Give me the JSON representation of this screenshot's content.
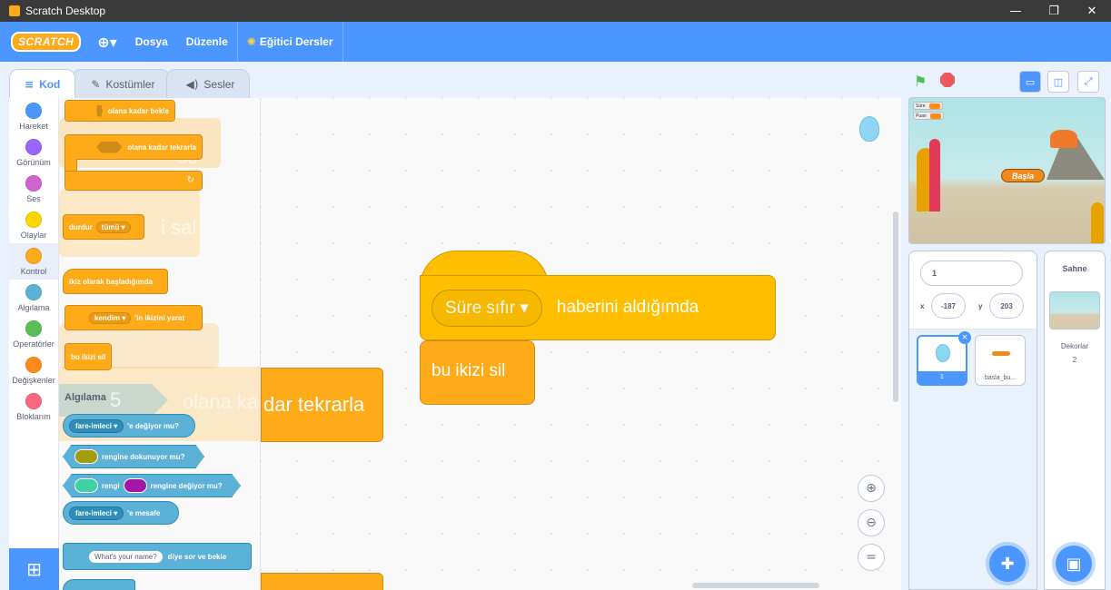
{
  "window": {
    "title": "Scratch Desktop",
    "min": "—",
    "max": "❐",
    "close": "✕"
  },
  "menu": {
    "logo": "SCRATCH",
    "globe": "⊕▾",
    "file": "Dosya",
    "edit": "Düzenle",
    "tutorials": "Eğitici Dersler"
  },
  "tabs": {
    "code": "Kod",
    "costumes": "Kostümler",
    "sounds": "Sesler"
  },
  "categories": [
    {
      "label": "Hareket",
      "color": "#4c97ff"
    },
    {
      "label": "Görünüm",
      "color": "#9966ff"
    },
    {
      "label": "Ses",
      "color": "#cf63cf"
    },
    {
      "label": "Olaylar",
      "color": "#ffd500"
    },
    {
      "label": "Kontrol",
      "color": "#ffab19"
    },
    {
      "label": "Algılama",
      "color": "#5cb1d6"
    },
    {
      "label": "Operatörler",
      "color": "#59c059"
    },
    {
      "label": "Değişkenler",
      "color": "#ff8c1a"
    },
    {
      "label": "Bloklarım",
      "color": "#ff6680"
    }
  ],
  "palette": {
    "wait_until": "olana kadar bekle",
    "repeat_until": "olana kadar tekrarla",
    "stop": "durdur",
    "stop_option": "tümü ▾",
    "clone_start": "ikiz olarak başladığımda",
    "clone_target": "kendim ▾",
    "clone_create": "'in ikizini yarat",
    "delete_clone": "bu ikizi sil",
    "sensing_title": "Algılama",
    "touching_target": "fare-imleci ▾",
    "touching_suffix": "'e değiyor mu?",
    "touching_color": "rengine dokunuyor mu?",
    "color_word": "rengi",
    "color_touch": "rengine değiyor mu?",
    "distance_target": "fare-imleci ▾",
    "distance_suffix": "'e mesafe",
    "ask_default": "What's your name?",
    "ask_suffix": "diye sor ve bekle",
    "ghost_number": "5",
    "ghost_text": "olana kadar tekrarla",
    "ghost_else": "se",
    "ghost_sal": "i sal"
  },
  "script": {
    "hat_message": "Süre sıfır",
    "hat_suffix": "haberini aldığımda",
    "delete_clone": "bu ikizi sil",
    "zoom_in": "⊕",
    "zoom_out": "⊖",
    "zoom_reset": "="
  },
  "stage": {
    "flag": "⚑",
    "var1": "Süre",
    "var2": "Puan",
    "start_button": "Başla"
  },
  "sprite_info": {
    "name": "1",
    "x_label": "x",
    "x": "-187",
    "y_label": "y",
    "y": "203"
  },
  "sprites": [
    {
      "name": "1"
    },
    {
      "name": "basla_bu..."
    }
  ],
  "backdrop": {
    "title": "Sahne",
    "label": "Dekorlar",
    "count": "2"
  }
}
